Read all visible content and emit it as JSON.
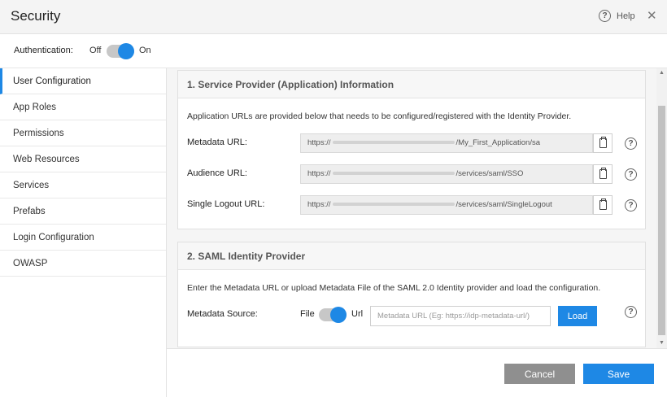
{
  "window": {
    "title": "Security",
    "help_label": "Help",
    "close_glyph": "✕"
  },
  "auth": {
    "label": "Authentication:",
    "off_label": "Off",
    "on_label": "On",
    "enabled": true
  },
  "sidebar": {
    "items": [
      {
        "label": "User Configuration",
        "active": true
      },
      {
        "label": "App Roles"
      },
      {
        "label": "Permissions"
      },
      {
        "label": "Web Resources"
      },
      {
        "label": "Services"
      },
      {
        "label": "Prefabs"
      },
      {
        "label": "Login Configuration"
      },
      {
        "label": "OWASP"
      }
    ]
  },
  "service_provider": {
    "heading": "1. Service Provider (Application) Information",
    "description": "Application URLs are provided below that needs to be configured/registered with the Identity Provider.",
    "rows": [
      {
        "label": "Metadata URL:",
        "prefix": "https://",
        "suffix": "/My_First_Application/sa"
      },
      {
        "label": "Audience URL:",
        "prefix": "https://",
        "suffix": "/services/saml/SSO"
      },
      {
        "label": "Single Logout URL:",
        "prefix": "https://",
        "suffix": "/services/saml/SingleLogout"
      }
    ]
  },
  "identity_provider": {
    "heading": "2. SAML Identity Provider",
    "description": "Enter the Metadata URL or upload Metadata File of the SAML 2.0 Identity provider and load the configuration.",
    "source_label": "Metadata Source:",
    "file_label": "File",
    "url_label": "Url",
    "selected_source": "Url",
    "input_value": "",
    "input_placeholder": "Metadata URL (Eg: https://idp-metadata-url/)",
    "load_label": "Load"
  },
  "footer": {
    "cancel_label": "Cancel",
    "save_label": "Save"
  },
  "colors": {
    "accent": "#1e88e5",
    "cancel": "#8f8f8f"
  }
}
